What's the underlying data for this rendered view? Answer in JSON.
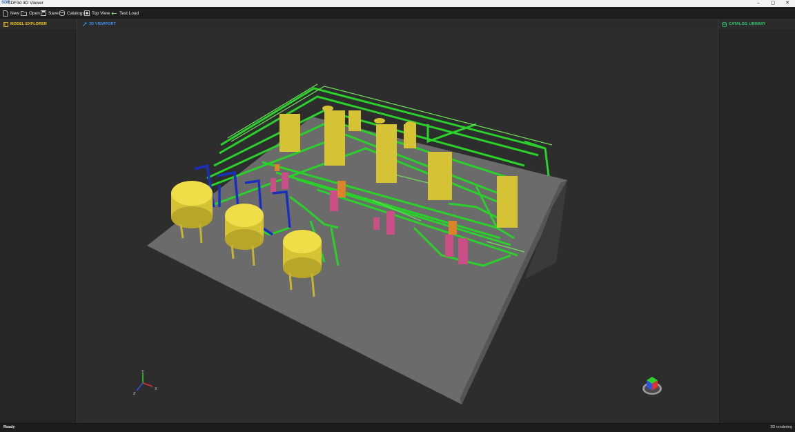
{
  "window": {
    "app_icon": "SDF",
    "title": "SDF3d 3D Viewer",
    "controls": [
      "–",
      "▢",
      "✕"
    ]
  },
  "toolbar": {
    "new_label": "New",
    "open_label": "Open",
    "save_label": "Save",
    "catalogs_label": "Catalogs",
    "topview_label": "Top View",
    "testload_label": "Test Load"
  },
  "panels": {
    "model_explorer": "MODEL EXPLORER",
    "viewport": "3D VIEWPORT",
    "catalog_library": "CATALOG LIBRARY"
  },
  "axes": {
    "x": "X",
    "y": "Y",
    "z": "Z"
  },
  "status": {
    "left": "Ready",
    "right": "3D rendering"
  },
  "colors": {
    "model_explorer_accent": "#f5c518",
    "viewport_accent": "#3d8fe6",
    "catalog_accent": "#2ecc71",
    "floor": "#6e6e6e",
    "vessel": "#e7d33a",
    "pipe_green": "#2bd12b",
    "pipe_blue": "#1a2fbf",
    "equipment_pink": "#c94f86",
    "equipment_orange": "#d9832a"
  },
  "icons": [
    "new-file-icon",
    "folder-open-icon",
    "save-icon",
    "catalogs-icon",
    "top-view-icon",
    "test-load-icon",
    "model-explorer-icon",
    "viewport-icon",
    "catalog-library-icon",
    "view-cube-icon"
  ]
}
